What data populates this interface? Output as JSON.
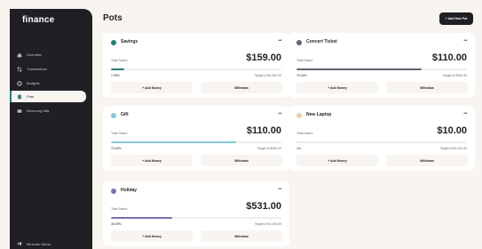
{
  "app": {
    "logo": "finance",
    "minimize_label": "Minimize Menu"
  },
  "sidebar": {
    "items": [
      {
        "label": "Overview",
        "icon": "home-icon"
      },
      {
        "label": "Transactions",
        "icon": "transactions-icon"
      },
      {
        "label": "Budgets",
        "icon": "budgets-icon"
      },
      {
        "label": "Pots",
        "icon": "pots-icon",
        "active": true
      },
      {
        "label": "Recurring bills",
        "icon": "recurring-bills-icon"
      }
    ]
  },
  "header": {
    "title": "Pots",
    "add_button": "+ Add New Pot"
  },
  "pots": [
    {
      "name": "Savings",
      "color": "#277c78",
      "total_label": "Total Saved",
      "total": "$159.00",
      "percent": "7.95%",
      "progress": 0.0795,
      "target": "Target of $2,000.00",
      "add_label": "+ Add Money",
      "withdraw_label": "Withdraw"
    },
    {
      "name": "Concert Ticket",
      "color": "#626070",
      "total_label": "Total Saved",
      "total": "$110.00",
      "percent": "73.33%",
      "progress": 0.7333,
      "target": "Target of $150.00",
      "add_label": "+ Add Money",
      "withdraw_label": "Withdraw"
    },
    {
      "name": "Gift",
      "color": "#82c9d7",
      "total_label": "Total Saved",
      "total": "$110.00",
      "percent": "73.33%",
      "progress": 0.7333,
      "target": "Target of $150.00",
      "add_label": "+ Add Money",
      "withdraw_label": "Withdraw"
    },
    {
      "name": "New Laptop",
      "color": "#f2cdac",
      "total_label": "Total Saved",
      "total": "$10.00",
      "percent": "1%",
      "progress": 0.01,
      "target": "Target of $1,000.00",
      "add_label": "+ Add Money",
      "withdraw_label": "Withdraw"
    },
    {
      "name": "Holiday",
      "color": "#826cb0",
      "total_label": "Total Saved",
      "total": "$531.00",
      "percent": "36.00%",
      "progress": 0.36,
      "target": "Target of $1,440.00",
      "add_label": "+ Add Money",
      "withdraw_label": "Withdraw"
    }
  ]
}
